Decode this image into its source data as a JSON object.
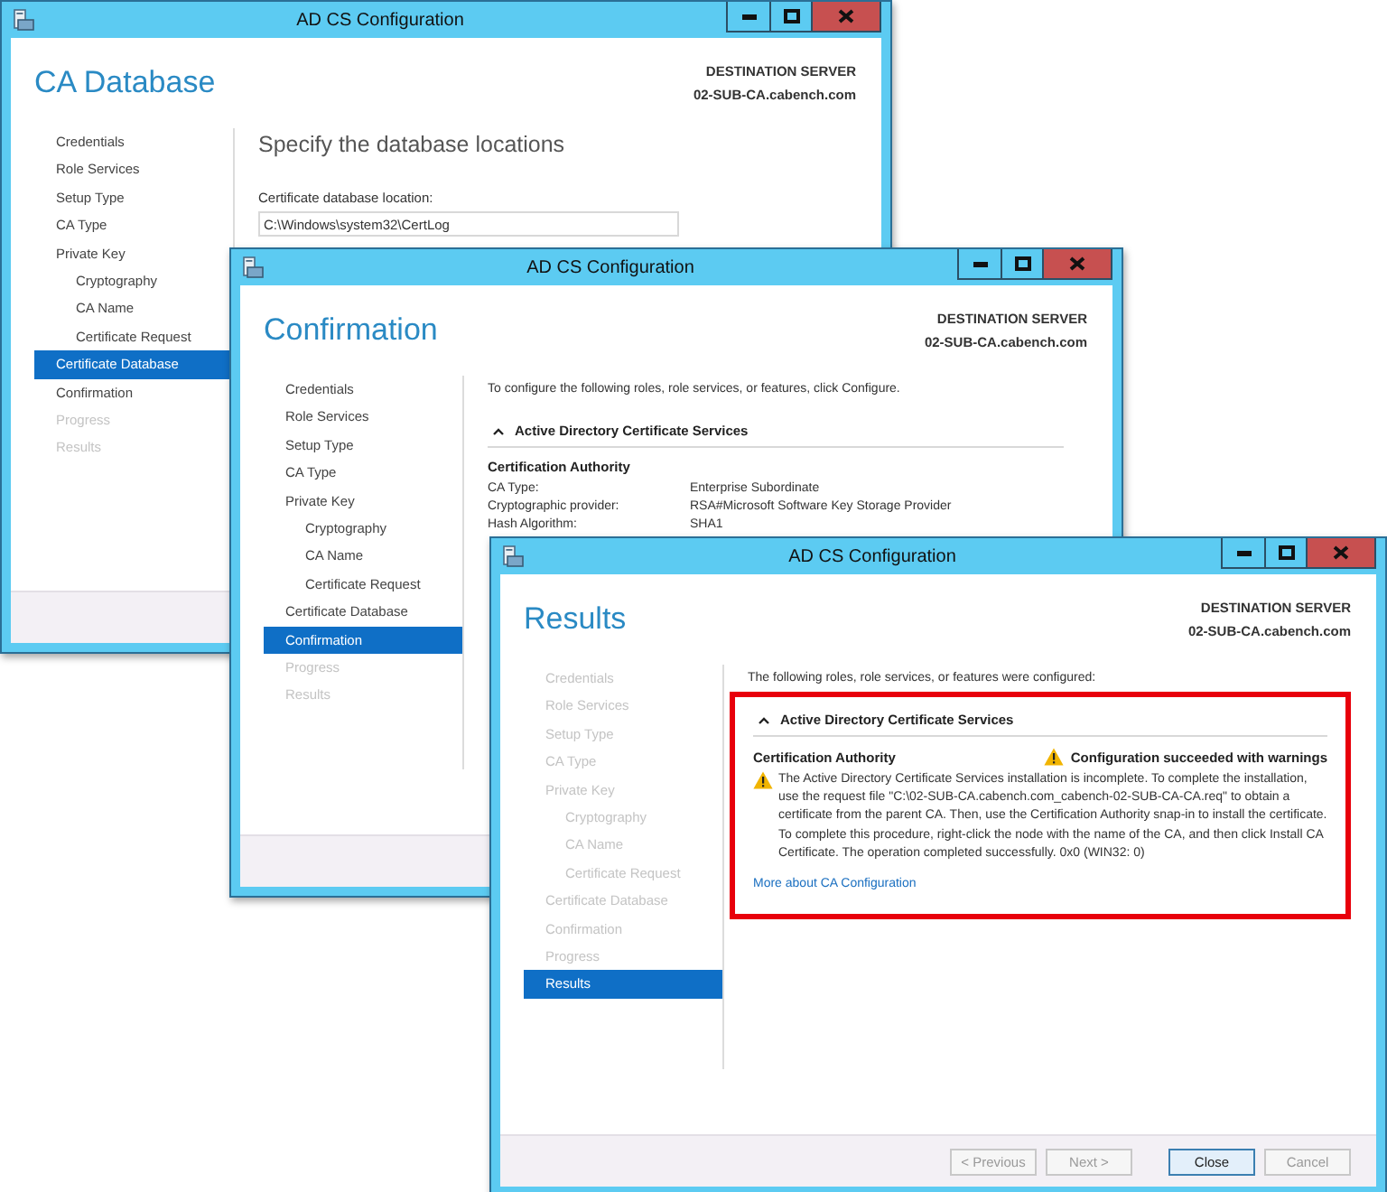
{
  "windows": [
    {
      "title": "AD CS Configuration",
      "heading": "CA Database",
      "destination_label": "DESTINATION SERVER",
      "destination_server": "02-SUB-CA.cabench.com",
      "nav": [
        {
          "label": "Credentials",
          "selected": false,
          "disabled": false
        },
        {
          "label": "Role Services",
          "selected": false,
          "disabled": false
        },
        {
          "label": "Setup Type",
          "selected": false,
          "disabled": false
        },
        {
          "label": "CA Type",
          "selected": false,
          "disabled": false
        },
        {
          "label": "Private Key",
          "selected": false,
          "disabled": false,
          "children": [
            {
              "label": "Cryptography",
              "selected": false,
              "disabled": false
            },
            {
              "label": "CA Name",
              "selected": false,
              "disabled": false
            },
            {
              "label": "Certificate Request",
              "selected": false,
              "disabled": false
            }
          ]
        },
        {
          "label": "Certificate Database",
          "selected": true,
          "disabled": false
        },
        {
          "label": "Confirmation",
          "selected": false,
          "disabled": false
        },
        {
          "label": "Progress",
          "selected": false,
          "disabled": true
        },
        {
          "label": "Results",
          "selected": false,
          "disabled": true
        }
      ],
      "page": {
        "kind": "database",
        "title": "Specify the database locations",
        "field_label": "Certificate database location:",
        "field_value": "C:\\Windows\\system32\\CertLog"
      }
    },
    {
      "title": "AD CS Configuration",
      "heading": "Confirmation",
      "destination_label": "DESTINATION SERVER",
      "destination_server": "02-SUB-CA.cabench.com",
      "nav": [
        {
          "label": "Credentials",
          "selected": false,
          "disabled": false
        },
        {
          "label": "Role Services",
          "selected": false,
          "disabled": false
        },
        {
          "label": "Setup Type",
          "selected": false,
          "disabled": false
        },
        {
          "label": "CA Type",
          "selected": false,
          "disabled": false
        },
        {
          "label": "Private Key",
          "selected": false,
          "disabled": false,
          "children": [
            {
              "label": "Cryptography",
              "selected": false,
              "disabled": false
            },
            {
              "label": "CA Name",
              "selected": false,
              "disabled": false
            },
            {
              "label": "Certificate Request",
              "selected": false,
              "disabled": false
            }
          ]
        },
        {
          "label": "Certificate Database",
          "selected": false,
          "disabled": false
        },
        {
          "label": "Confirmation",
          "selected": true,
          "disabled": false
        },
        {
          "label": "Progress",
          "selected": false,
          "disabled": true
        },
        {
          "label": "Results",
          "selected": false,
          "disabled": true
        }
      ],
      "page": {
        "kind": "confirmation",
        "intro": "To configure the following roles, role services, or features, click Configure.",
        "section": {
          "title": "Active Directory Certificate Services",
          "expanded": true
        },
        "subheading": "Certification Authority",
        "rows": [
          {
            "key": "CA Type:",
            "value": "Enterprise Subordinate"
          },
          {
            "key": "Cryptographic provider:",
            "value": "RSA#Microsoft Software Key Storage Provider"
          },
          {
            "key": "Hash Algorithm:",
            "value": "SHA1"
          }
        ]
      }
    },
    {
      "title": "AD CS Configuration",
      "heading": "Results",
      "destination_label": "DESTINATION SERVER",
      "destination_server": "02-SUB-CA.cabench.com",
      "nav": [
        {
          "label": "Credentials",
          "selected": false,
          "disabled": true
        },
        {
          "label": "Role Services",
          "selected": false,
          "disabled": true
        },
        {
          "label": "Setup Type",
          "selected": false,
          "disabled": true
        },
        {
          "label": "CA Type",
          "selected": false,
          "disabled": true
        },
        {
          "label": "Private Key",
          "selected": false,
          "disabled": true,
          "children": [
            {
              "label": "Cryptography",
              "selected": false,
              "disabled": true
            },
            {
              "label": "CA Name",
              "selected": false,
              "disabled": true
            },
            {
              "label": "Certificate Request",
              "selected": false,
              "disabled": true
            }
          ]
        },
        {
          "label": "Certificate Database",
          "selected": false,
          "disabled": true
        },
        {
          "label": "Confirmation",
          "selected": false,
          "disabled": true
        },
        {
          "label": "Progress",
          "selected": false,
          "disabled": true
        },
        {
          "label": "Results",
          "selected": true,
          "disabled": false
        }
      ],
      "page": {
        "kind": "results",
        "intro": "The following roles, role services, or features were configured:",
        "section": {
          "title": "Active Directory Certificate Services",
          "expanded": true,
          "highlighted": true
        },
        "subheading": "Certification Authority",
        "status": "Configuration succeeded with warnings",
        "message": "The Active Directory Certificate Services installation is incomplete. To complete the installation, use the request file \"C:\\02-SUB-CA.cabench.com_cabench-02-SUB-CA-CA.req\" to obtain a certificate from the parent CA. Then, use the Certification Authority snap-in to install the certificate. To complete this procedure, right-click the node with the name of the CA, and then click Install CA Certificate. The operation completed successfully. 0x0 (WIN32: 0)",
        "link": "More about CA Configuration"
      },
      "buttons": [
        {
          "label": "< Previous",
          "default": false,
          "disabled": true
        },
        {
          "label": "Next >",
          "default": false,
          "disabled": true
        },
        {
          "label": "Close",
          "default": true,
          "disabled": false
        },
        {
          "label": "Cancel",
          "default": false,
          "disabled": true
        }
      ]
    }
  ]
}
